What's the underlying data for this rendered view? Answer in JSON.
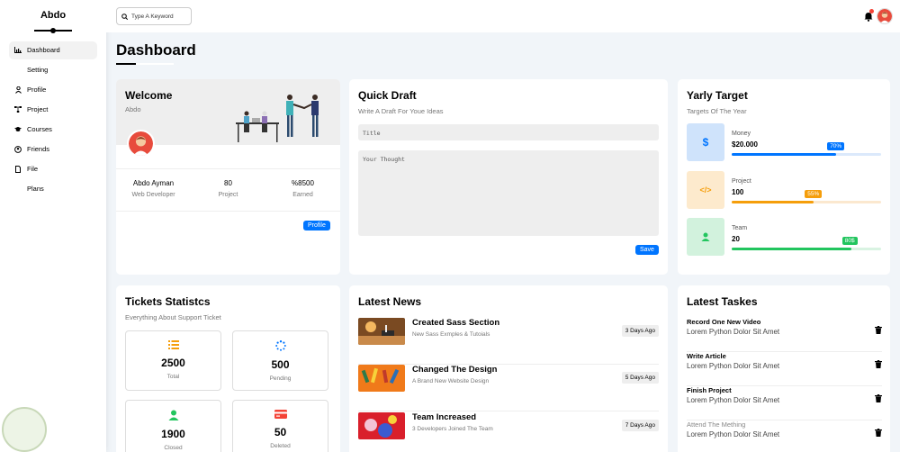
{
  "brand": "Abdo",
  "nav": [
    {
      "label": "Dashboard",
      "icon": "chart-icon",
      "active": true
    },
    {
      "label": "Setting",
      "icon": "gear-icon",
      "active": false
    },
    {
      "label": "Profile",
      "icon": "user-icon",
      "active": false
    },
    {
      "label": "Project",
      "icon": "diagram-icon",
      "active": false
    },
    {
      "label": "Courses",
      "icon": "graduation-cap-icon",
      "active": false
    },
    {
      "label": "Friends",
      "icon": "circle-user-icon",
      "active": false
    },
    {
      "label": "File",
      "icon": "file-icon",
      "active": false
    },
    {
      "label": "Plans",
      "icon": "plans-icon",
      "active": false
    }
  ],
  "header": {
    "search_placeholder": "Type A Keyword"
  },
  "page_title": "Dashboard",
  "welcome": {
    "title": "Welcome",
    "subtitle": "Abdo",
    "stats": [
      {
        "value": "Abdo Ayman",
        "label": "Web Developer"
      },
      {
        "value": "80",
        "label": "Project"
      },
      {
        "value": "%8500",
        "label": "Earned"
      }
    ],
    "button": "Profile"
  },
  "quick_draft": {
    "title": "Quick Draft",
    "subtitle": "Write A Draft For Youe Ideas",
    "title_placeholder": "Title",
    "thought_placeholder": "Your Thought",
    "button": "Save"
  },
  "yearly_target": {
    "title": "Yarly Target",
    "subtitle": "Targets Of The Year",
    "items": [
      {
        "label": "Money",
        "value": "$20.000",
        "percent_text": "70%",
        "percent": 70,
        "icon": "dollar-icon",
        "icon_text": "$",
        "color": "#0075ff",
        "bg": "#cfe3fb",
        "track": "#dbe9fb"
      },
      {
        "label": "Project",
        "value": "100",
        "percent_text": "55%",
        "percent": 55,
        "icon": "code-icon",
        "icon_text": "</>",
        "color": "#f59e0b",
        "bg": "#fdeacd",
        "track": "#fbe8cf"
      },
      {
        "label": "Team",
        "value": "20",
        "percent_text": "80$",
        "percent": 80,
        "icon": "users-icon",
        "icon_text": "",
        "color": "#22c55e",
        "bg": "#d2f2dd",
        "track": "#d9f3e2"
      }
    ]
  },
  "tickets": {
    "title": "Tickets Statistcs",
    "subtitle": "Everything About Support Ticket",
    "items": [
      {
        "value": "2500",
        "label": "Total",
        "icon": "list-icon",
        "color": "#f59e0b"
      },
      {
        "value": "500",
        "label": "Pending",
        "icon": "spinner-icon",
        "color": "#0075ff"
      },
      {
        "value": "1900",
        "label": "Closed",
        "icon": "check-user-icon",
        "color": "#22c55e"
      },
      {
        "value": "50",
        "label": "Deleted",
        "icon": "card-icon",
        "color": "#f44336"
      }
    ]
  },
  "news": {
    "title": "Latest News",
    "items": [
      {
        "title": "Created Sass Section",
        "sub": "New Sass Exmples & Tutoials",
        "date": "3 Days Ago"
      },
      {
        "title": "Changed The Design",
        "sub": "A Brand New Website Design",
        "date": "5 Days Ago"
      },
      {
        "title": "Team Increased",
        "sub": "3 Developers Joined The Team",
        "date": "7 Days Ago"
      }
    ]
  },
  "tasks": {
    "title": "Latest Taskes",
    "items": [
      {
        "title": "Record One New Video",
        "desc": "Lorem Python Dolor Sit Amet",
        "done": false
      },
      {
        "title": "Write Article",
        "desc": "Lorem Python Dolor Sit Amet",
        "done": false
      },
      {
        "title": "Finish Project",
        "desc": "Lorem Python Dolor Sit Amet",
        "done": false
      },
      {
        "title": "Attend The Mething",
        "desc": "Lorem Python Dolor Sit Amet",
        "done": true
      }
    ]
  }
}
